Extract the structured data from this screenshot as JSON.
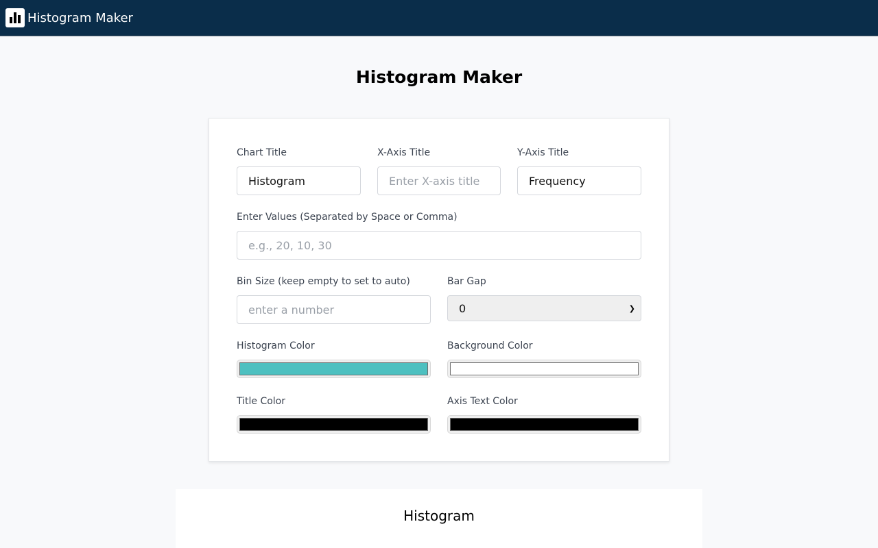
{
  "navbar": {
    "brand": "Histogram Maker",
    "logo_icon": "bar-chart-icon"
  },
  "page": {
    "title": "Histogram Maker"
  },
  "form": {
    "chart_title": {
      "label": "Chart Title",
      "value": "Histogram",
      "placeholder": ""
    },
    "x_axis_title": {
      "label": "X-Axis Title",
      "value": "",
      "placeholder": "Enter X-axis title"
    },
    "y_axis_title": {
      "label": "Y-Axis Title",
      "value": "Frequency",
      "placeholder": ""
    },
    "values": {
      "label": "Enter Values (Separated by Space or Comma)",
      "value": "",
      "placeholder": "e.g., 20, 10, 30"
    },
    "bin_size": {
      "label": "Bin Size (keep empty to set to auto)",
      "value": "",
      "placeholder": "enter a number"
    },
    "bar_gap": {
      "label": "Bar Gap",
      "selected": "0"
    },
    "histogram_color": {
      "label": "Histogram Color",
      "value": "#4dc0c0"
    },
    "background_color": {
      "label": "Background Color",
      "value": "#ffffff"
    },
    "title_color": {
      "label": "Title Color",
      "value": "#000000"
    },
    "axis_text_color": {
      "label": "Axis Text Color",
      "value": "#000000"
    }
  },
  "preview": {
    "title": "Histogram"
  }
}
